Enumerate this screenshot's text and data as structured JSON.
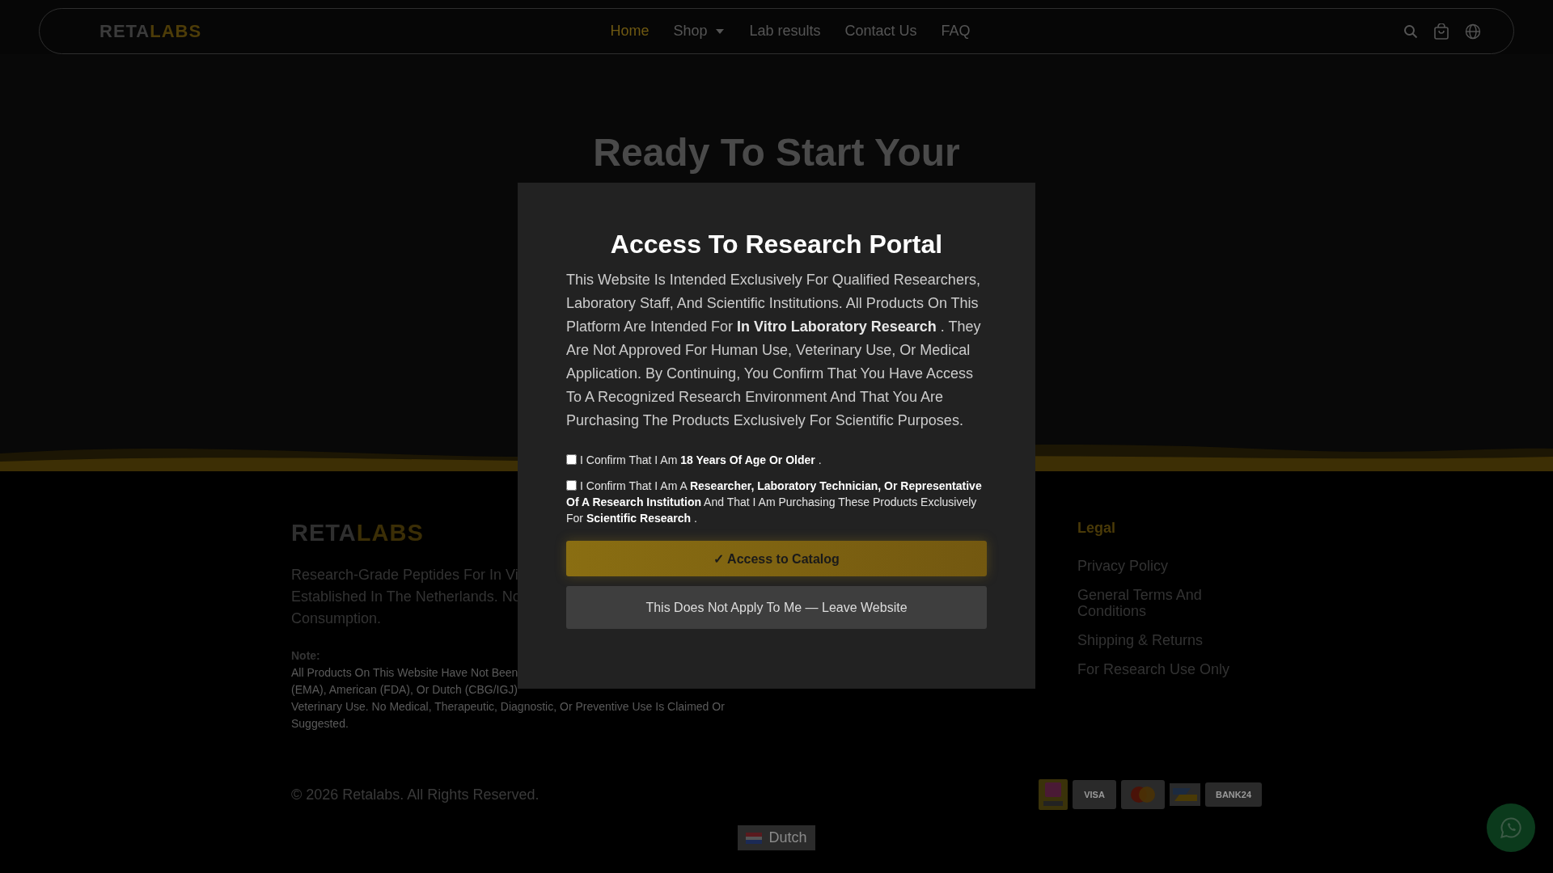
{
  "header": {
    "logo": {
      "first": "RETA",
      "second": "LABS"
    },
    "nav": [
      {
        "label": "Home",
        "selected": true,
        "dropdown": false
      },
      {
        "label": "Shop",
        "selected": false,
        "dropdown": true
      },
      {
        "label": "Lab results",
        "selected": false,
        "dropdown": false
      },
      {
        "label": "Contact Us",
        "selected": false,
        "dropdown": false
      },
      {
        "label": "FAQ",
        "selected": false,
        "dropdown": false
      }
    ]
  },
  "hero": {
    "heading": "Ready To Start Your"
  },
  "footer": {
    "logo": {
      "first": "RETA",
      "second": "LABS"
    },
    "description_lines": [
      "Research-Grade Peptides For In Vi",
      "Established In The Netherlands. No",
      "Consumption."
    ],
    "note_label": "Note:",
    "note_lines": [
      "All Products On This Website Have Not Been",
      "(EMA), American (FDA), Or Dutch (CBG/IGJ)",
      "Veterinary Use. No Medical, Therapeutic, Diagnostic, Or Preventive Use Is Claimed Or",
      "Suggested."
    ],
    "legal": {
      "heading": "Legal",
      "links": [
        "Privacy Policy",
        "General Terms And Conditions",
        "Shipping & Returns",
        "For Research Use Only"
      ]
    },
    "copyright": "© 2026 Retalabs. All Rights Reserved.",
    "payment_methods": [
      {
        "kind": "wero"
      },
      {
        "kind": "visa",
        "label": "VISA"
      },
      {
        "kind": "mastercard"
      },
      {
        "kind": "bancontact"
      },
      {
        "kind": "bank",
        "label": "BANK24"
      }
    ],
    "language": {
      "label": "Dutch"
    }
  },
  "modal": {
    "title": "Access To Research Portal",
    "text": "This Website Is Intended Exclusively For Qualified Researchers, Laboratory Staff, And Scientific Institutions. All Products On This Platform Are Intended For **In Vitro Laboratory Research** . They Are Not Approved For Human Use, Veterinary Use, Or Medical Application. By Continuing, You Confirm That You Have Access To A Recognized Research Environment And That You Are Purchasing The Products Exclusively For Scientific Purposes.",
    "confirmations": [
      {
        "text": "I Confirm That I Am **18 Years Of Age Or Older** .",
        "checked": false
      },
      {
        "text": "I Confirm That I Am A **Researcher, Laboratory Technician, Or Representative Of A Research Institution** And That I Am Purchasing These Products Exclusively For **Scientific Research** .",
        "checked": false
      }
    ],
    "buttons": [
      {
        "label": "✓ Access to Catalog",
        "kind": "primary"
      },
      {
        "label": "This Does Not Apply To Me — Leave Website",
        "kind": "secondary"
      }
    ]
  }
}
